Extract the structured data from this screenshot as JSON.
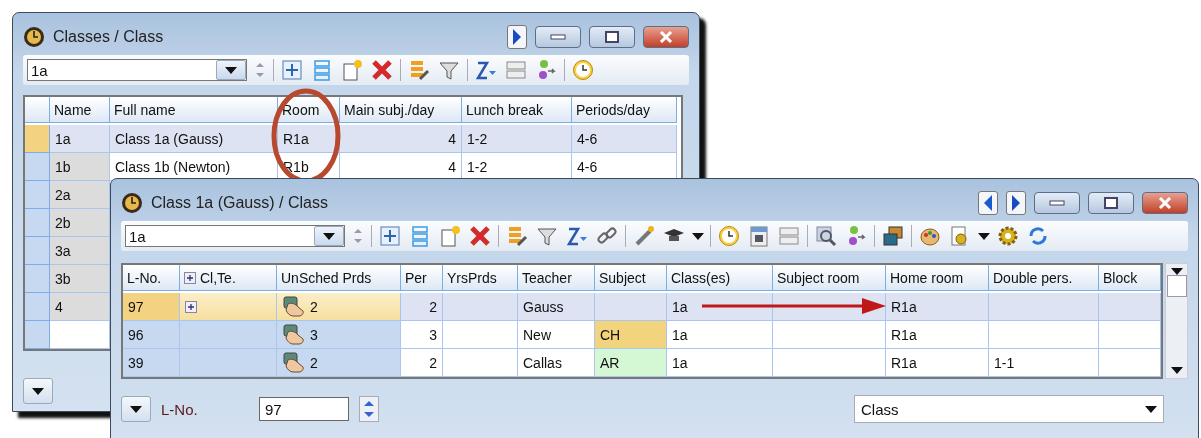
{
  "back_window": {
    "title": "Classes / Class",
    "selector": {
      "value": "1a"
    },
    "columns": [
      "Name",
      "Full name",
      "Room",
      "Main subj./day",
      "Lunch break",
      "Periods/day"
    ],
    "rows": [
      {
        "selected": true,
        "cells": [
          "1a",
          "Class 1a (Gauss)",
          "R1a",
          "4",
          "1-2",
          "4-6"
        ]
      },
      {
        "selected": false,
        "cells": [
          "1b",
          "Class 1b (Newton)",
          "R1b",
          "4",
          "1-2",
          "4-6"
        ]
      },
      {
        "selected": false,
        "cells": [
          "2a"
        ]
      },
      {
        "selected": false,
        "cells": [
          "2b"
        ]
      },
      {
        "selected": false,
        "cells": [
          "3a"
        ]
      },
      {
        "selected": false,
        "cells": [
          "3b"
        ]
      },
      {
        "selected": false,
        "cells": [
          "4"
        ]
      }
    ]
  },
  "front_window": {
    "title": "Class 1a (Gauss) / Class",
    "selector": {
      "value": "1a"
    },
    "columns": [
      "L-No.",
      "Cl,Te.",
      "UnSched Prds",
      "Per",
      "YrsPrds",
      "Teacher",
      "Subject",
      "Class(es)",
      "Subject room",
      "Home room",
      "Double pers.",
      "Block"
    ],
    "rows": [
      {
        "selected": true,
        "l_no": "97",
        "expandable": true,
        "unsched_prds": "2",
        "per": "2",
        "teacher": "Gauss",
        "classes": "1a",
        "home_room": "R1a"
      },
      {
        "selected": false,
        "l_no": "96",
        "expandable": false,
        "unsched_prds": "3",
        "per": "3",
        "teacher": "New",
        "subject": {
          "text": "CH",
          "color": "#f2d47e"
        },
        "classes": "1a",
        "home_room": "R1a"
      },
      {
        "selected": false,
        "l_no": "39",
        "expandable": false,
        "unsched_prds": "2",
        "per": "2",
        "teacher": "Callas",
        "subject": {
          "text": "AR",
          "color": "#d4f7d4"
        },
        "classes": "1a",
        "home_room": "R1a",
        "double_pers": "1-1"
      }
    ],
    "footer": {
      "field_label": "L-No.",
      "field_value": "97",
      "view_select": "Class"
    }
  }
}
